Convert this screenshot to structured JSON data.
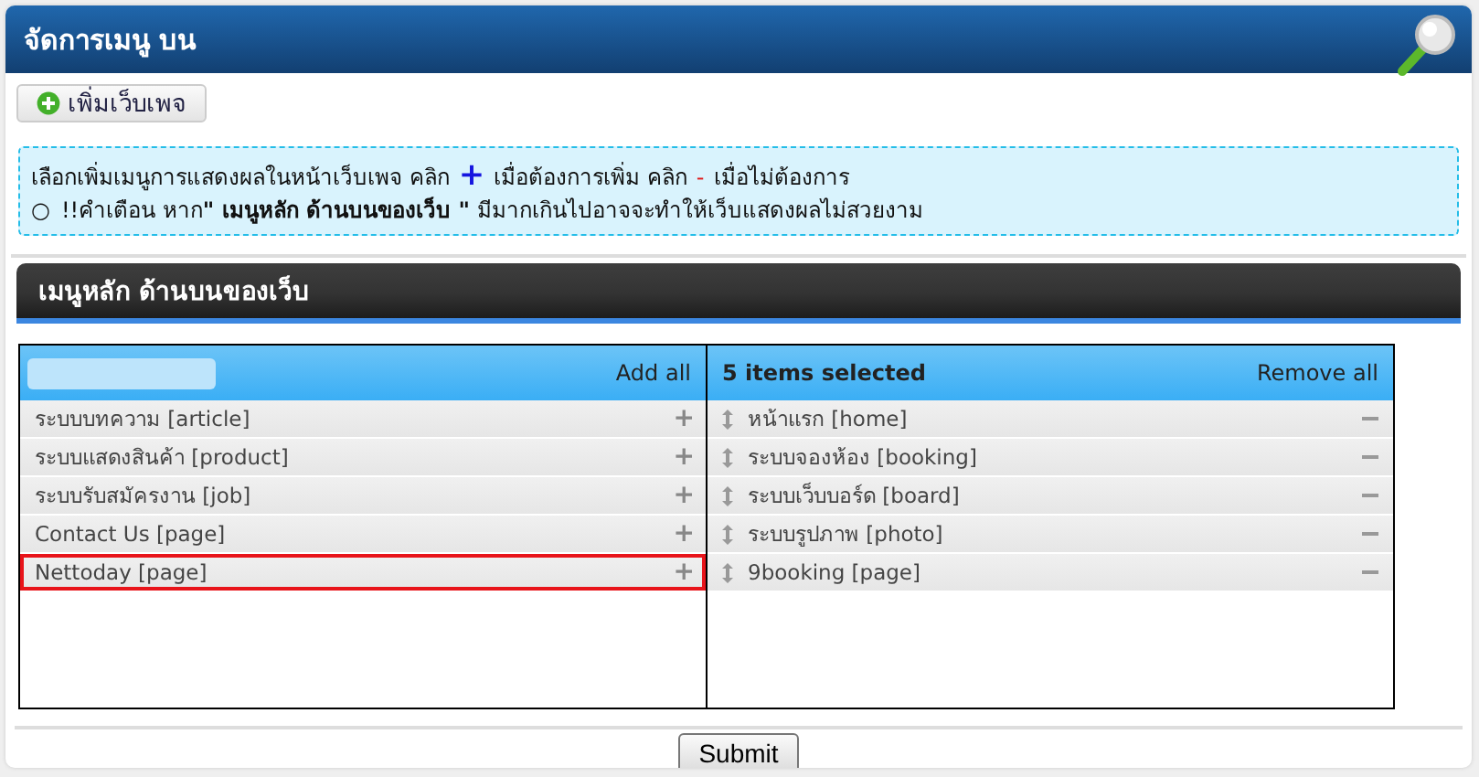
{
  "window": {
    "title": "จัดการเมนู บน"
  },
  "toolbar": {
    "add_button": "เพิ่มเว็บเพจ"
  },
  "notice": {
    "line_1": [
      {
        "kind": "text",
        "text": "เลือกเพิ่มเมนูการแสดงผลในหน้าเว็บเพจ คลิก"
      },
      {
        "kind": "plus",
        "text": "+"
      },
      {
        "kind": "text",
        "text": "เมื่อต้องการเพิ่ม คลิก"
      },
      {
        "kind": "minus",
        "text": "-"
      },
      {
        "kind": "text",
        "text": "เมื่อไม่ต้องการ"
      }
    ],
    "bullet": "○",
    "line_2": "!!คำเตือน หาก**\" เมนูหลัก ด้านบนของเว็บ \"** มีมากเกินไปอาจจะทำให้เว็บแสดงผลไม่สวยงาม"
  },
  "section": {
    "title": "เมนูหลัก ด้านบนของเว็บ"
  },
  "available": {
    "action": "Add all",
    "items": [
      {
        "label": "ระบบบทความ [article]",
        "icon": "+",
        "highlighted": false
      },
      {
        "label": "ระบบแสดงสินค้า [product]",
        "icon": "+",
        "highlighted": false
      },
      {
        "label": "ระบบรับสมัครงาน [job]",
        "icon": "+",
        "highlighted": false
      },
      {
        "label": "Contact Us [page]",
        "icon": "+",
        "highlighted": false
      },
      {
        "label": "Nettoday [page]",
        "icon": "+",
        "highlighted": true
      }
    ]
  },
  "selected": {
    "count": "5 items selected",
    "action": "Remove all",
    "items": [
      {
        "label": "หน้าแรก [home]"
      },
      {
        "label": "ระบบจองห้อง [booking]"
      },
      {
        "label": "ระบบเว็บบอร์ด [board]"
      },
      {
        "label": "ระบบรูปภาพ [photo]"
      },
      {
        "label": "9booking [page]"
      }
    ]
  },
  "submit": "Submit"
}
